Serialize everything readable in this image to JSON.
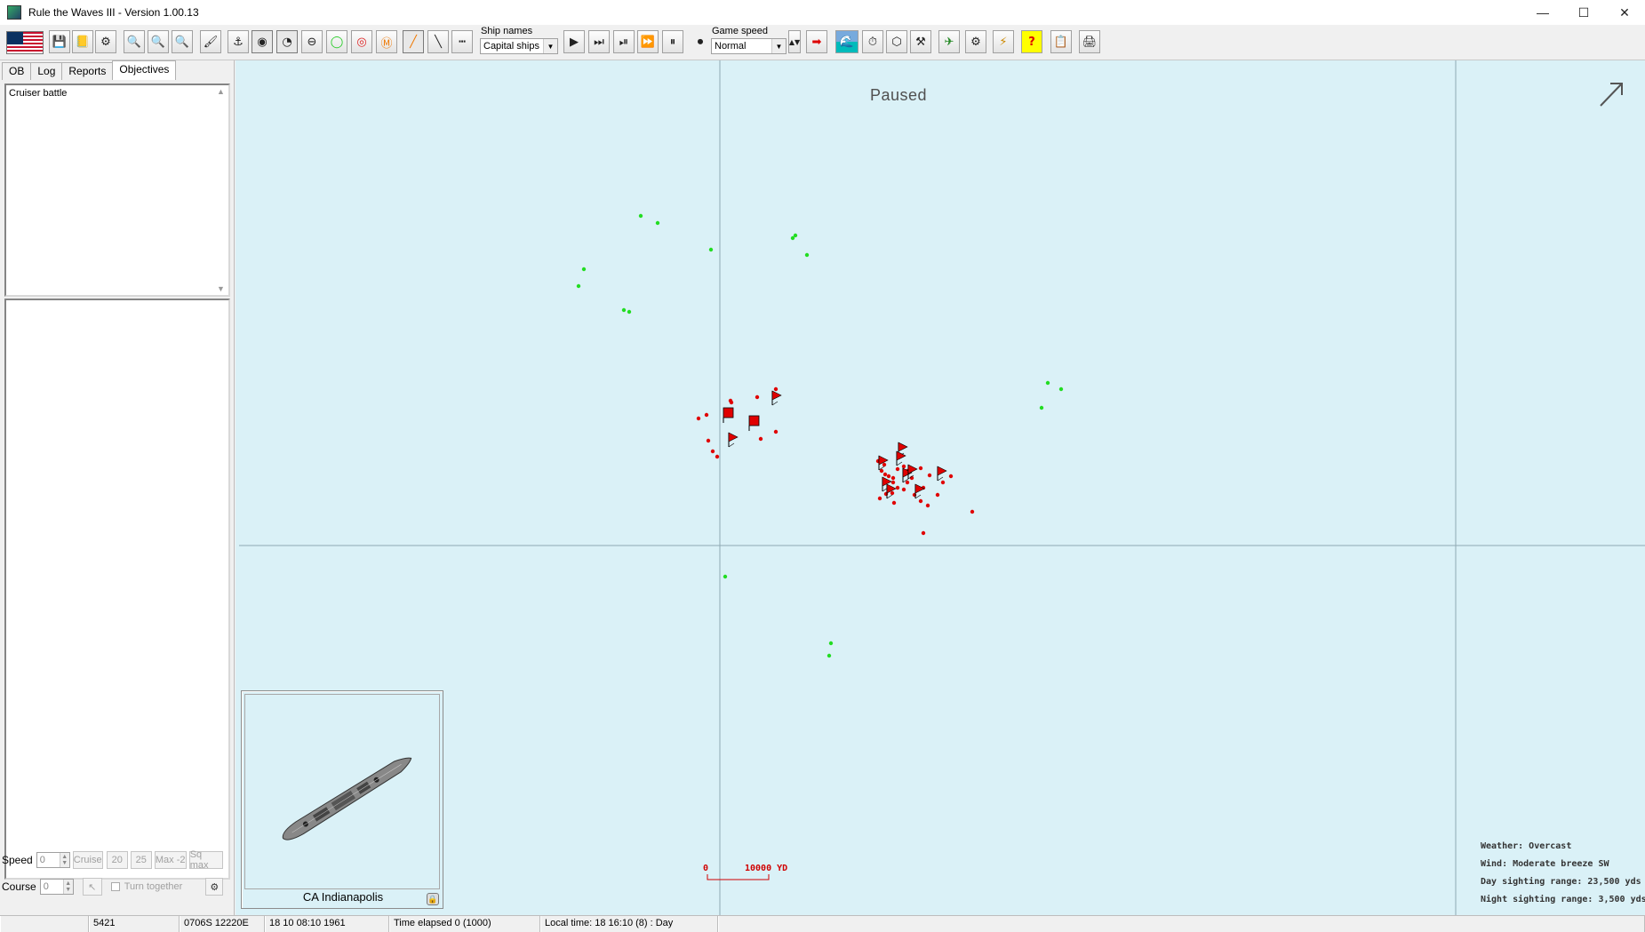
{
  "window": {
    "title": "Rule the Waves III - Version 1.00.13",
    "minimize": "—",
    "maximize": "☐",
    "close": "✕"
  },
  "toolbar": {
    "ship_names_label": "Ship names",
    "ship_names_value": "Capital ships",
    "game_speed_label": "Game speed",
    "game_speed_value": "Normal",
    "buttons": [
      "💾",
      "📒",
      "⚙",
      "🔍",
      "🔍",
      "🔍",
      "🖌",
      "⚓",
      "◉",
      "◔",
      "⊖",
      "◯",
      "◎",
      "Ⓜ",
      "╱",
      "╲",
      "┅",
      "▶",
      "⏭",
      "⏯",
      "⏩",
      "⏸",
      "⏺",
      "➡",
      "🌊",
      "⏱",
      "⬡",
      "⚒",
      "✈",
      "⚙",
      "⚡",
      "?",
      "📋",
      "🖨"
    ]
  },
  "left_panel": {
    "tabs": [
      "OB",
      "Log",
      "Reports",
      "Objectives"
    ],
    "active_tab": "Objectives",
    "objective_text": "Cruiser battle",
    "speed_label": "Speed",
    "speed_value": "0",
    "course_label": "Course",
    "course_value": "0",
    "speed_buttons": [
      "Cruise",
      "20",
      "25",
      "Max -2",
      "Sq max"
    ],
    "turn_together_label": "Turn together"
  },
  "map": {
    "status": "Paused",
    "selected_ship": "CA Indianapolis",
    "scale_zero": "0",
    "scale_label": "10000 YD",
    "weather": "Weather: Overcast",
    "wind": "Wind: Moderate breeze  SW",
    "day_sighting": "Day sighting range: 23,500 yds",
    "night_sighting": "Night sighting range: 3,500 yds",
    "colors": {
      "sea": "#daf1f7",
      "own": "#e00000",
      "enemy": "#22dd22"
    },
    "wind_arrow_icon": "arrow-up-right-icon"
  },
  "statusbar": {
    "cells": [
      "",
      "5421",
      "0706S 12220E",
      "18 10 08:10 1961",
      "Time elapsed 0 (1000)",
      "Local time: 18 16:10 (8) : Day",
      ""
    ]
  }
}
